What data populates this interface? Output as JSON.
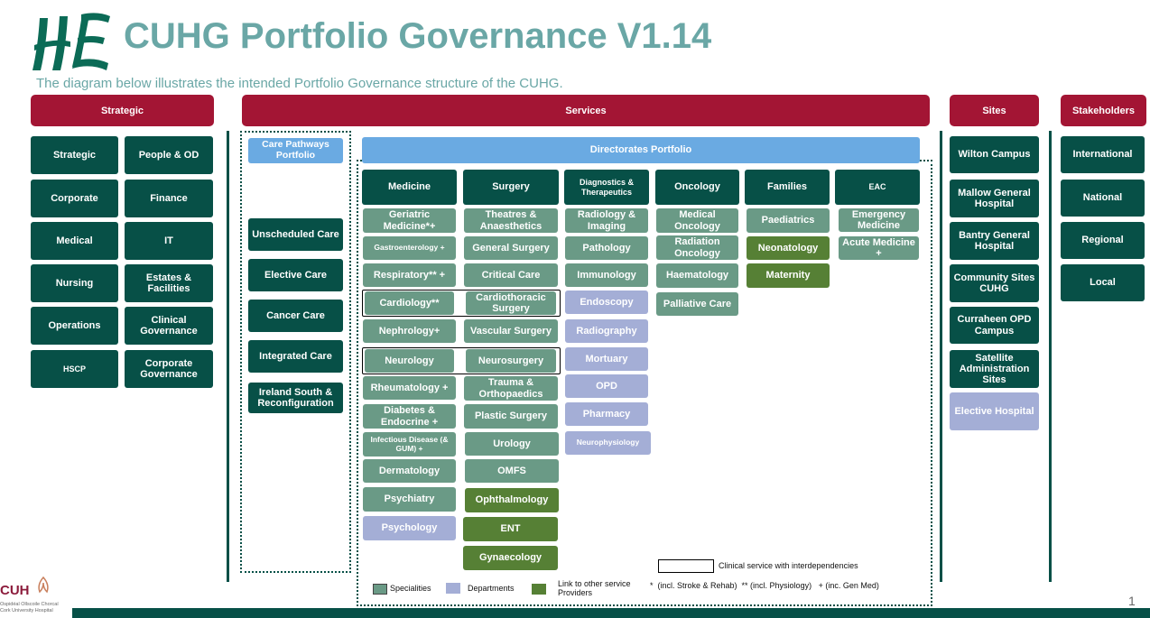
{
  "header": {
    "title": "CUHG Portfolio Governance V1.14",
    "subtitle": "The diagram below illustrates the intended Portfolio Governance structure of the CUHG."
  },
  "section_headers": {
    "strategic": "Strategic",
    "services": "Services",
    "sites": "Sites",
    "stakeholders": "Stakeholders"
  },
  "strategic_items": [
    "Strategic",
    "People & OD",
    "Corporate",
    "Finance",
    "Medical",
    "IT",
    "Nursing",
    "Estates & Facilities",
    "Operations",
    "Clinical Governance",
    "HSCP",
    "Corporate Governance"
  ],
  "care_pathways": {
    "title": "Care Pathways Portfolio",
    "items": [
      "Unscheduled Care",
      "Elective Care",
      "Cancer Care",
      "Integrated Care",
      "Ireland South & Reconfiguration"
    ]
  },
  "directorates_title": "Directorates Portfolio",
  "directorates": [
    {
      "name": "Medicine",
      "items": [
        "Geriatric Medicine*+",
        "Gastroenterology +",
        "Respiratory** +",
        "Cardiology**",
        "Nephrology+",
        "Neurology",
        "Rheumatology +",
        "Diabetes & Endocrine +",
        "Infectious Disease (& GUM) +",
        "Dermatology",
        "Psychiatry",
        "Psychology"
      ]
    },
    {
      "name": "Surgery",
      "items": [
        "Theatres & Anaesthetics",
        "General Surgery",
        "Critical Care",
        "Cardiothoracic Surgery",
        "Vascular Surgery",
        "Neurosurgery",
        "Trauma & Orthopaedics",
        "Plastic Surgery",
        "Urology",
        "OMFS",
        "Ophthalmology",
        "ENT",
        "Gynaecology"
      ]
    },
    {
      "name": "Diagnostics & Therapeutics",
      "items": [
        "Radiology & Imaging",
        "Pathology",
        "Immunology",
        "Endoscopy",
        "Radiography",
        "Mortuary",
        "OPD",
        "Pharmacy",
        "Neurophysiology"
      ]
    },
    {
      "name": "Oncology",
      "items": [
        "Medical Oncology",
        "Radiation Oncology",
        "Haematology",
        "Palliative Care"
      ]
    },
    {
      "name": "Families",
      "items": [
        "Paediatrics",
        "Neonatology",
        "Maternity"
      ]
    },
    {
      "name": "EAC",
      "items": [
        "Emergency Medicine",
        "Acute Medicine +"
      ]
    }
  ],
  "sites": [
    "Wilton Campus",
    "Mallow General Hospital",
    "Bantry General Hospital",
    "Community Sites CUHG",
    "Curraheen OPD Campus",
    "Satellite Administration Sites",
    "Elective Hospital"
  ],
  "stakeholders": [
    "International",
    "National",
    "Regional",
    "Local"
  ],
  "legend": {
    "interdependencies": "Clinical service with interdependencies",
    "specialities": "Specialities",
    "departments": "Departments",
    "link_other": "Link to other service Providers",
    "notes": "*  (incl. Stroke & Rehab)  ** (incl. Physiology)   + (inc. Gen Med)"
  },
  "footer": {
    "logo_text": "CUH",
    "logo_sub1": "Ospidéal Ollscoile Chorcaí",
    "logo_sub2": "Cork University Hospital",
    "page_number": "1"
  },
  "colors": {
    "dark_green": "#075047",
    "sage": "#6a9a86",
    "lavender": "#a4aed6",
    "leaf_green": "#568035",
    "light_blue": "#6aaae2",
    "crimson": "#a31534",
    "title_teal": "#6aa7a6"
  }
}
